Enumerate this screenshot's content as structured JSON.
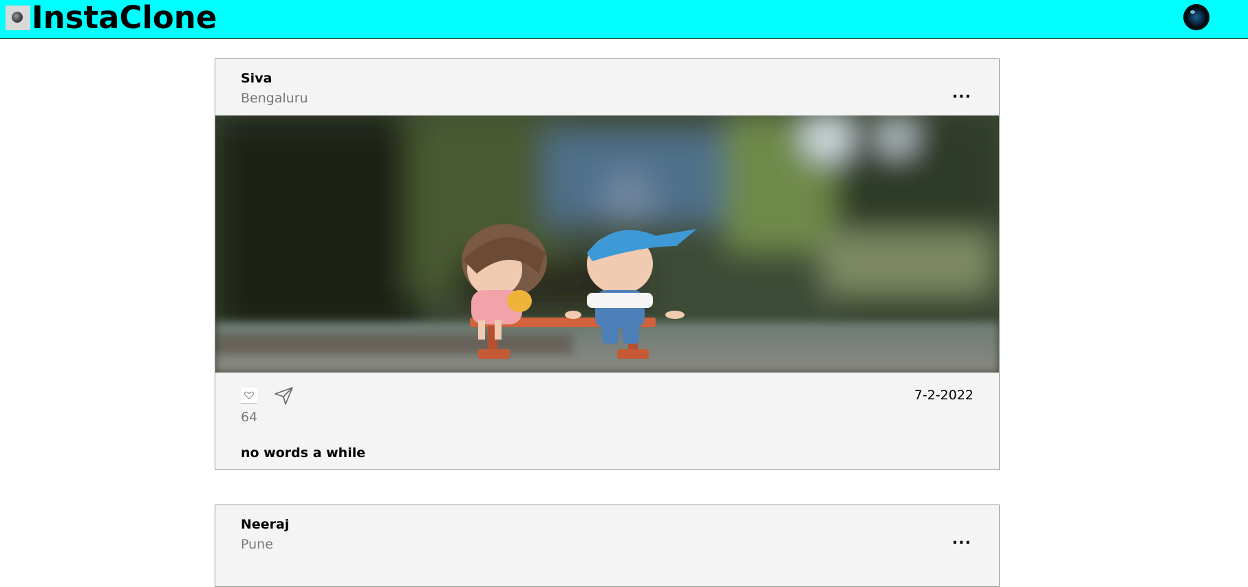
{
  "header": {
    "brand": "InstaClone",
    "logo_icon": "app-logo-icon",
    "camera_icon": "camera-icon",
    "background_color": "#00ffff"
  },
  "posts": [
    {
      "author": "Siva",
      "location": "Bengaluru",
      "more": "...",
      "image_icon": "photo-two-figurines-on-bench",
      "like_icon": "heart-icon",
      "share_icon": "paper-plane-icon",
      "date": "7-2-2022",
      "likes": "64",
      "caption": "no words a while"
    },
    {
      "author": "Neeraj",
      "location": "Pune",
      "more": "..."
    }
  ]
}
